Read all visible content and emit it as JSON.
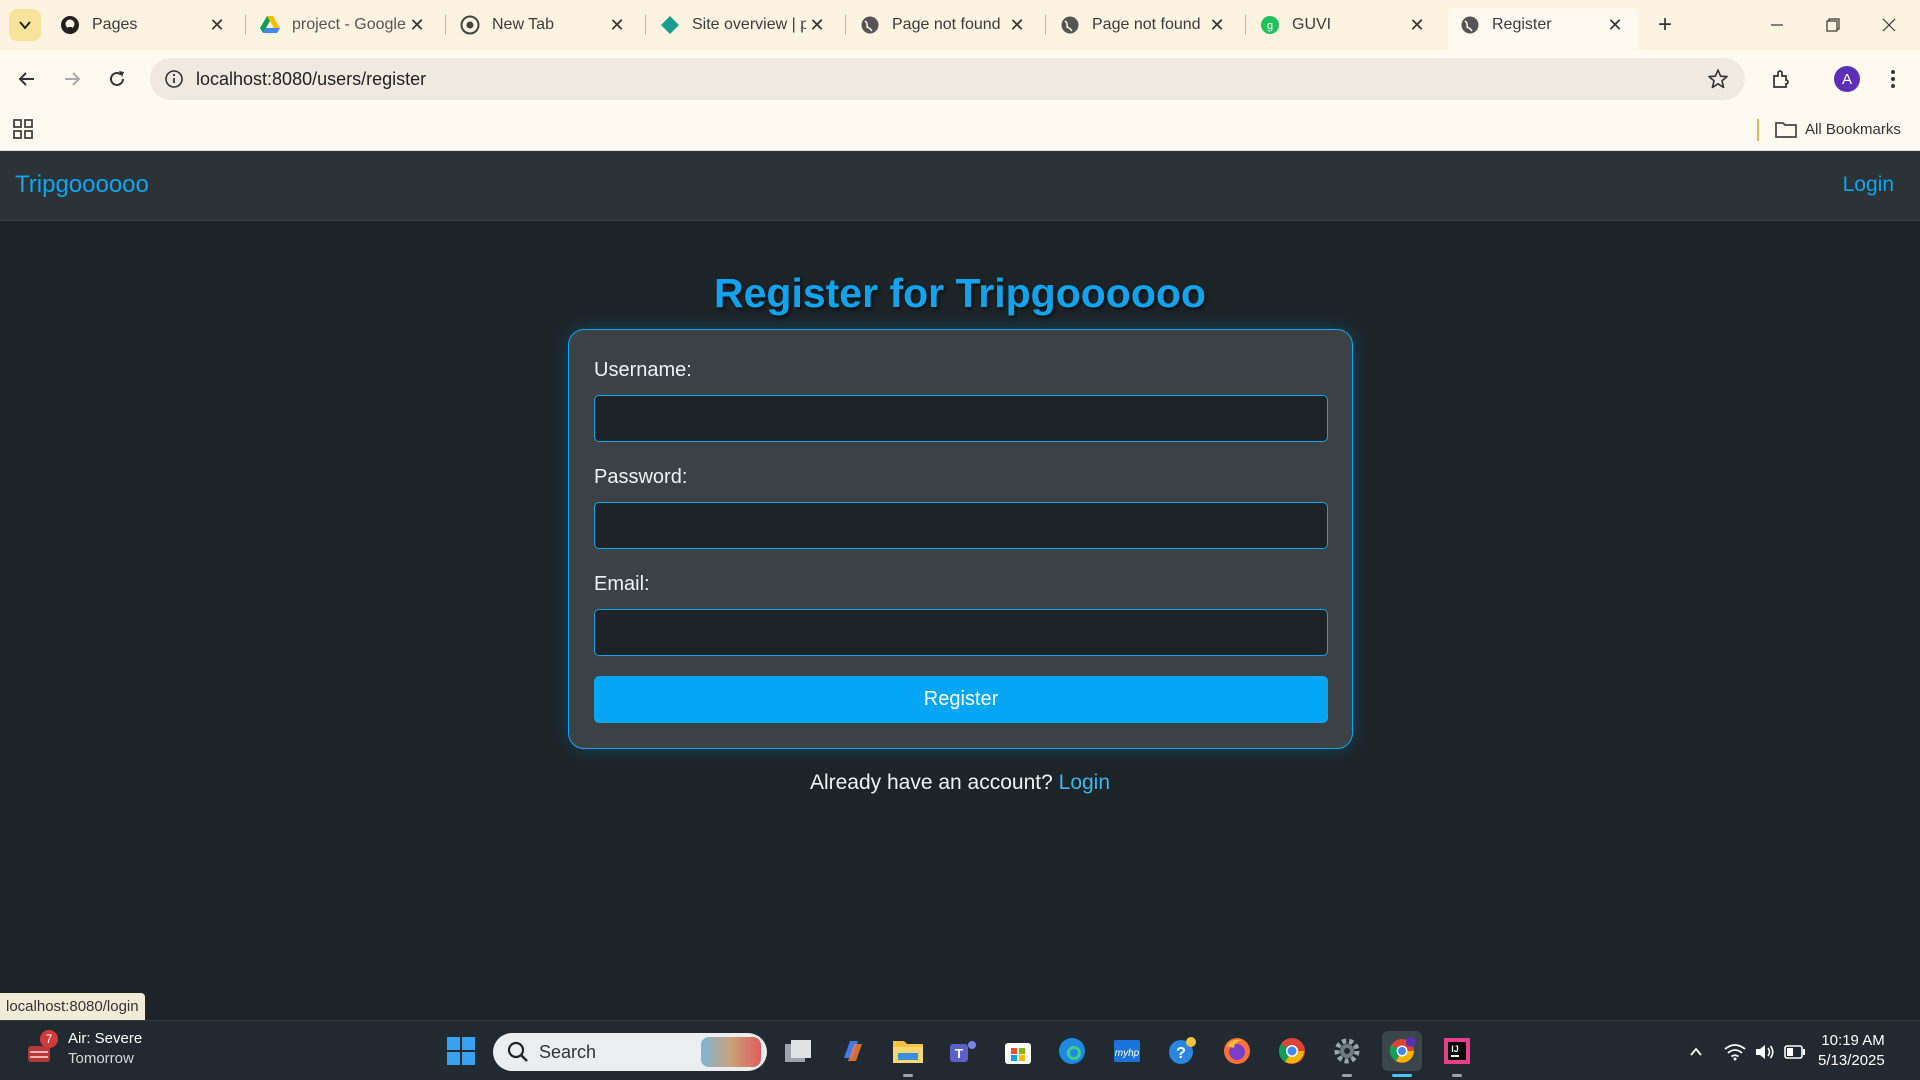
{
  "browser": {
    "tabs": [
      {
        "title": "Pages",
        "icon": "github-icon"
      },
      {
        "title": "project - Google",
        "icon": "google-drive-icon"
      },
      {
        "title": "New Tab",
        "icon": "chrome-globe-icon"
      },
      {
        "title": "Site overview | p",
        "icon": "netlify-diamond-icon"
      },
      {
        "title": "Page not found",
        "icon": "globe-icon"
      },
      {
        "title": "Page not found",
        "icon": "globe-icon"
      },
      {
        "title": "GUVI",
        "icon": "guvi-icon"
      },
      {
        "title": "Register",
        "icon": "globe-icon",
        "active": true
      }
    ],
    "url": "localhost:8080/users/register",
    "profile_initial": "A",
    "bookmarks_label": "All Bookmarks",
    "status_url": "localhost:8080/login"
  },
  "app": {
    "brand": "Tripgoooooo",
    "nav_login": "Login",
    "heading": "Register for Tripgoooooo",
    "form": {
      "username_label": "Username:",
      "password_label": "Password:",
      "email_label": "Email:",
      "username_value": "",
      "password_value": "",
      "email_value": "",
      "submit_label": "Register"
    },
    "footer_text": "Already have an account?",
    "footer_link": "Login",
    "colors": {
      "accent": "#0ea5f0",
      "background": "#1c2428",
      "card": "#3a4246"
    }
  },
  "taskbar": {
    "weather_title": "Air: Severe",
    "weather_sub": "Tomorrow",
    "weather_badge": "7",
    "search_label": "Search",
    "time": "10:19 AM",
    "date": "5/13/2025"
  }
}
